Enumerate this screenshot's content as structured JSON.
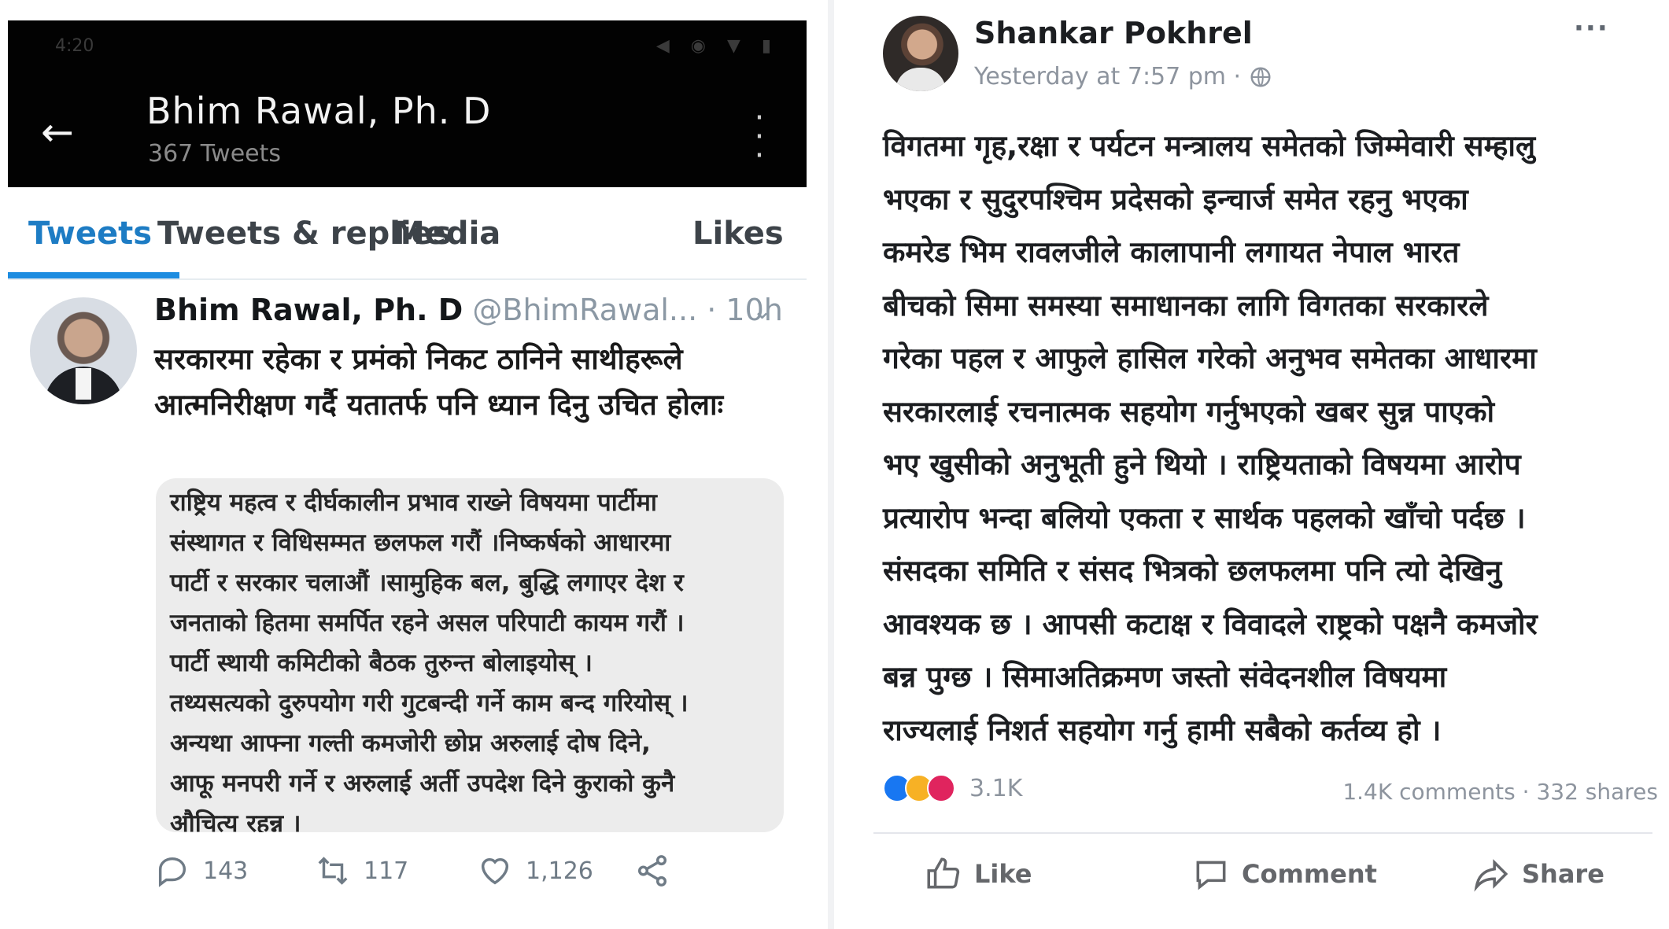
{
  "twitter": {
    "status_bar": {
      "time": "4:20",
      "icons": "◀ ◉ ▼ ▮"
    },
    "header": {
      "profile_name": "Bhim Rawal, Ph. D",
      "tweet_count": "367 Tweets"
    },
    "tabs": [
      "Tweets",
      "Tweets & replies",
      "Media",
      "Likes"
    ],
    "active_tab": "Tweets",
    "tweet": {
      "author": "Bhim Rawal, Ph. D",
      "handle": "@BhimRawal...",
      "time": " · 10h",
      "text": "सरकारमा रहेका र प्रमंको निकट ठानिने साथीहरूले आत्मनिरीक्षण गर्दै यतातर्फ पनि ध्यान दिनु उचित होलाः",
      "quote_lines": [
        "राष्ट्रिय महत्व र दीर्घकालीन प्रभाव राख्ने विषयमा पार्टीमा",
        "संस्थागत र विधिसम्मत छलफल गरौं ।निष्कर्षको आधारमा",
        "पार्टी र सरकार चलाऔं ।सामुहिक बल, बुद्धि लगाएर देश र",
        "जनताको हितमा समर्पित रहने असल परिपाटी कायम गरौं ।",
        "पार्टी स्थायी कमिटीको बैठक तुरुन्त बोलाइयोस् ।",
        "तथ्यसत्यको दुरुपयोग गरी गुटबन्दी गर्ने काम बन्द गरियोस् ।",
        "अन्यथा आफ्ना गल्ती कमजोरी छोप्न अरुलाई दोष दिने,",
        "आफू मनपरी गर्ने र अरुलाई अर्ती उपदेश दिने कुराको कुनै",
        "औचित्य रहन्न ।"
      ],
      "replies": "143",
      "retweets": "117",
      "likes": "1,126"
    }
  },
  "facebook": {
    "author": "Shankar Pokhrel",
    "time": "Yesterday at 7:57 pm ·",
    "more": "···",
    "text_lines": [
      "विगतमा गृह,रक्षा र पर्यटन मन्त्रालय समेतको जिम्मेवारी सम्हालु",
      "भएका र सुदुरपश्चिम प्रदेसको इन्चार्ज समेत रहनु भएका",
      "कमरेड भिम रावलजीले कालापानी लगायत नेपाल भारत",
      "बीचको सिमा समस्या समाधानका लागि विगतका सरकारले",
      "गरेका पहल र आफुले हासिल गरेको अनुभव समेतका आधारमा",
      "सरकारलाई रचनात्मक सहयोग गर्नुभएको खबर सुन्न पाएको",
      "भए खुसीको अनुभूती हुने थियो । राष्ट्रियताको विषयमा आरोप",
      "प्रत्यारोप भन्दा बलियो एकता र सार्थक पहलको खाँचो पर्दछ ।",
      "संसदका समिति र संसद भित्रको छलफलमा पनि त्यो देखिनु",
      "आवश्यक छ । आपसी कटाक्ष र विवादले राष्ट्रको पक्षनै कमजोर",
      "बन्न पुग्छ । सिमाअतिक्रमण जस्तो संवेदनशील विषयमा",
      "राज्यलाई निशर्त सहयोग गर्नु हामी सबैको कर्तव्य हो ।"
    ],
    "reactions_count": "3.1K",
    "stats": "1.4K comments · 332 shares",
    "buttons": {
      "like": "Like",
      "comment": "Comment",
      "share": "Share"
    },
    "colors": {
      "like_blue": "#1877f2",
      "haha_yellow": "#f7b125",
      "angry_red": "#e0245e"
    }
  },
  "colors": {
    "twitter_blue": "#1d8ce0",
    "header_black": "#020202"
  }
}
